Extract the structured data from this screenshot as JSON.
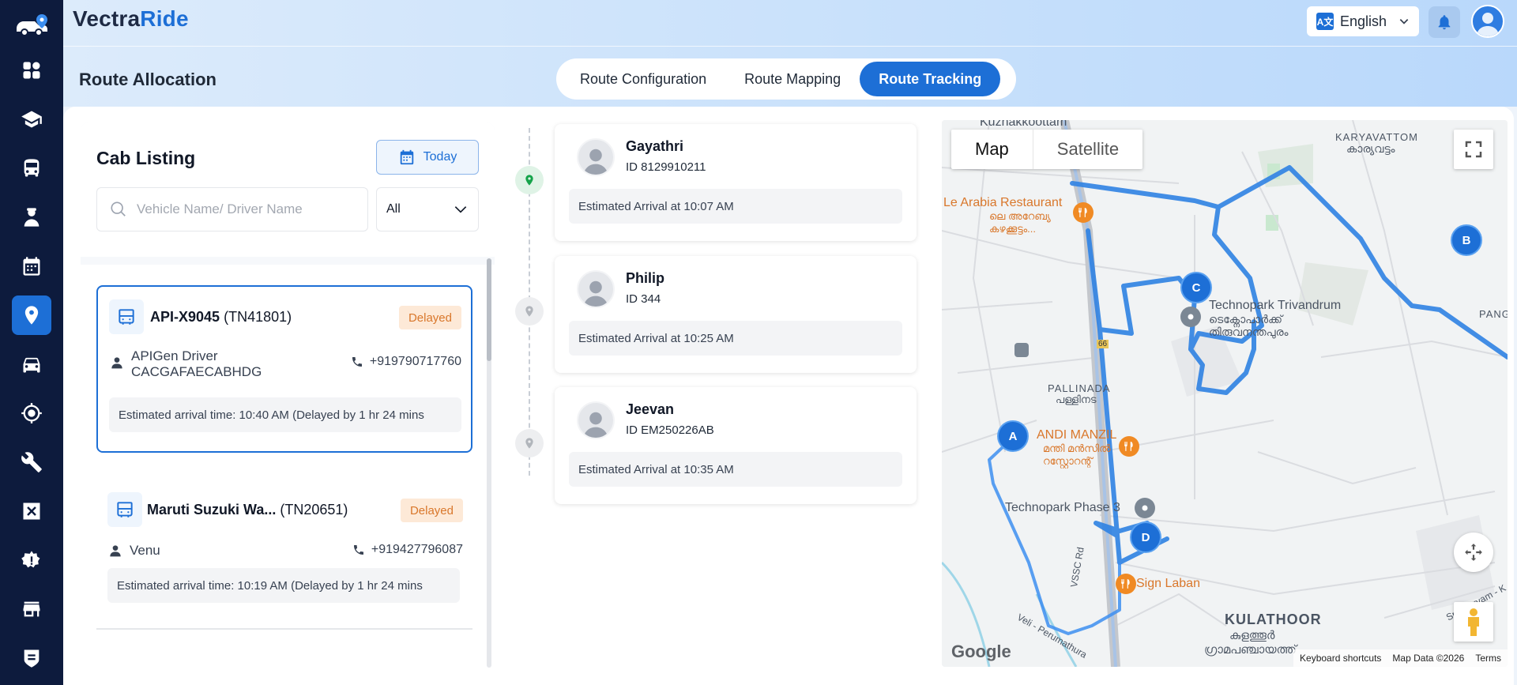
{
  "brand": {
    "name_part1": "Vectra",
    "name_part2": "Ride"
  },
  "header": {
    "language": "English",
    "language_badge": "A文",
    "page_title": "Route Allocation",
    "tabs": [
      {
        "label": "Route Configuration",
        "active": false
      },
      {
        "label": "Route Mapping",
        "active": false
      },
      {
        "label": "Route Tracking",
        "active": true
      }
    ]
  },
  "sidebar": {
    "items": [
      {
        "icon": "dashboard-icon"
      },
      {
        "icon": "graduation-cap-icon"
      },
      {
        "icon": "bus-icon"
      },
      {
        "icon": "driver-icon"
      },
      {
        "icon": "calendar-icon"
      },
      {
        "icon": "location-pin-icon",
        "active": true
      },
      {
        "icon": "car-icon"
      },
      {
        "icon": "crosshair-icon"
      },
      {
        "icon": "wrench-icon"
      },
      {
        "icon": "close-box-icon"
      },
      {
        "icon": "alert-gear-icon"
      },
      {
        "icon": "store-icon"
      },
      {
        "icon": "shield-icon"
      }
    ]
  },
  "cab_listing": {
    "title": "Cab Listing",
    "today_label": "Today",
    "search_placeholder": "Vehicle Name/ Driver Name",
    "filter_value": "All",
    "cabs": [
      {
        "vehicle": "API-X9045",
        "code": "(TN41801)",
        "status": "Delayed",
        "driver": "APIGen Driver CACGAFAECABHDG",
        "phone": "+919790717760",
        "eta": "Estimated arrival time: 10:40 AM (Delayed by 1 hr 24 mins"
      },
      {
        "vehicle": "Maruti Suzuki Wa...",
        "code": "(TN20651)",
        "status": "Delayed",
        "driver": "Venu",
        "phone": "+919427796087",
        "eta": "Estimated arrival time: 10:19 AM (Delayed by 1 hr 24 mins"
      }
    ]
  },
  "passengers": [
    {
      "name": "Gayathri",
      "id": "ID 8129910211",
      "eta": "Estimated Arrival at 10:07 AM",
      "stop_status": "reached"
    },
    {
      "name": "Philip",
      "id": "ID 344",
      "eta": "Estimated Arrival at 10:25 AM",
      "stop_status": "pending"
    },
    {
      "name": "Jeevan",
      "id": "ID EM250226AB",
      "eta": "Estimated Arrival at 10:35 AM",
      "stop_status": "pending"
    }
  ],
  "map": {
    "type_options": [
      "Map",
      "Satellite"
    ],
    "selected_type": "Map",
    "markers": [
      "A",
      "B",
      "C",
      "D"
    ],
    "labels": {
      "top_area": "Kuzhakkoottam",
      "karyavattom": "KARYAVATTOM",
      "karyavattom_ml": "കാര്യവട്ടം",
      "restaurant": "Le Arabia Restaurant",
      "restaurant_ml_1": "ലെ അറേബ്യ",
      "restaurant_ml_2": "കഴക്കൂട്ടം...",
      "technopark": "Technopark Trivandrum",
      "technopark_ml_1": "ടെക്നോപാർക്ക്",
      "technopark_ml_2": "തിരുവനന്തപുരം",
      "pallinada": "PALLINADA",
      "pallinada_ml": "പള്ളിനട",
      "mandi": "ANDI MANZIL",
      "mandi_ml_1": "മന്തി മൻസിൽ",
      "mandi_ml_2": "റസ്റ്റോറന്റ്",
      "phase3": "Technopark Phase 3",
      "sign_laban": "Sign Laban",
      "kulathoor": "KULATHOOR",
      "kulathoor_ml_1": "കുളത്തൂർ",
      "kulathoor_ml_2": "ഗ്രാമപഞ്ചായത്ത്",
      "pang": "PANG",
      "road_nh": "66",
      "vssc": "VSSC Rd",
      "veli": "Veli - Perumathura",
      "sreekaryam": "Sreekaryam - K"
    },
    "google": "Google",
    "attribution": [
      "Keyboard shortcuts",
      "Map Data ©2026",
      "Terms"
    ]
  }
}
